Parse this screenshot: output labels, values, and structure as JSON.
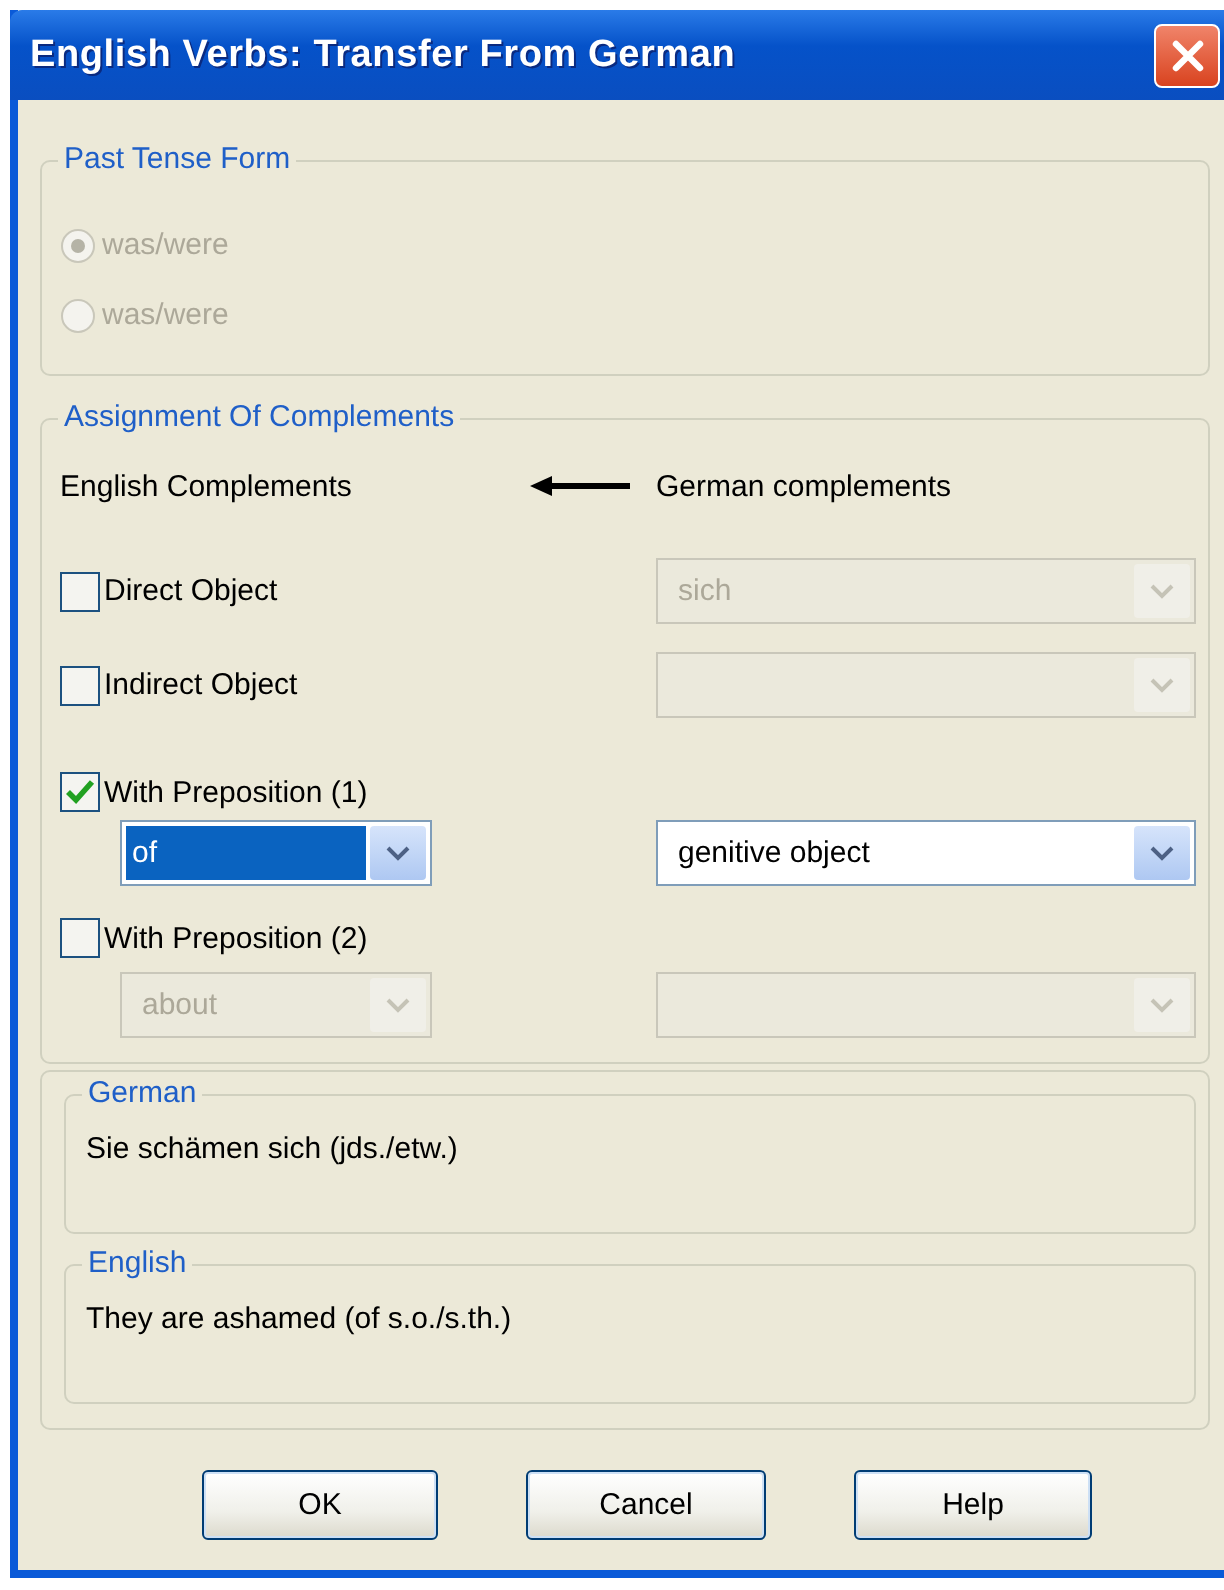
{
  "window": {
    "title": "English Verbs: Transfer From German"
  },
  "past_tense": {
    "legend": "Past Tense Form",
    "options": [
      {
        "label": "was/were",
        "selected": true,
        "disabled": true
      },
      {
        "label": "was/were",
        "selected": false,
        "disabled": true
      }
    ]
  },
  "complements": {
    "legend": "Assignment Of Complements",
    "english_heading": "English Complements",
    "german_heading": "German complements",
    "rows": [
      {
        "kind": "single",
        "label": "Direct Object",
        "checked": false,
        "german": {
          "value": "sich",
          "disabled": true,
          "highlighted": false
        }
      },
      {
        "kind": "single",
        "label": "Indirect Object",
        "checked": false,
        "german": {
          "disabled": true,
          "highlighted": false
        }
      },
      {
        "kind": "preposition",
        "label": "With Preposition (1)",
        "checked": true,
        "preposition": {
          "value": "of",
          "disabled": false,
          "highlighted": true
        },
        "german": {
          "value": "genitive object",
          "disabled": false,
          "highlighted": false
        }
      },
      {
        "kind": "preposition",
        "label": "With Preposition (2)",
        "checked": false,
        "preposition": {
          "value": "about",
          "disabled": true,
          "highlighted": false
        },
        "german": {
          "disabled": true,
          "highlighted": false
        }
      }
    ]
  },
  "examples": [
    {
      "legend": "German",
      "text": "Sie schämen sich (jds./etw.)"
    },
    {
      "legend": "English",
      "text": "They are ashamed (of s.o./s.th.)"
    }
  ],
  "buttons": [
    {
      "label": "OK"
    },
    {
      "label": "Cancel"
    },
    {
      "label": "Help"
    }
  ]
}
